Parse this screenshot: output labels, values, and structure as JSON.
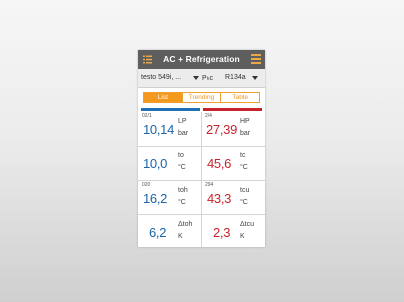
{
  "header": {
    "title": "AC + Refrigeration",
    "menu_icon": "list-icon",
    "hamburger_icon": "hamburger-icon"
  },
  "selectors": {
    "device": "testo 549i, ...",
    "param": "Pₕc",
    "refrigerant": "R134a"
  },
  "tabs": [
    {
      "label": "List"
    },
    {
      "label": "Trending"
    },
    {
      "label": "Table"
    }
  ],
  "colors": {
    "low": "#1a63a8",
    "high": "#c8232c",
    "accent": "#f39a1e",
    "header": "#5e5e5e"
  },
  "cells": [
    {
      "code": "02/1",
      "value": "10,14",
      "label1": "LP",
      "label2": "bar",
      "color": "blue"
    },
    {
      "code": "2/4",
      "value": "27,39",
      "label1": "HP",
      "label2": "bar",
      "color": "red"
    },
    {
      "code": "",
      "value": "10,0",
      "label1": "to",
      "label2": "°C",
      "color": "blue"
    },
    {
      "code": "",
      "value": "45,6",
      "label1": "tc",
      "label2": "°C",
      "color": "red"
    },
    {
      "code": "020",
      "value": "16,2",
      "label1": "toh",
      "label2": "°C",
      "color": "blue"
    },
    {
      "code": "294",
      "value": "43,3",
      "label1": "tcu",
      "label2": "°C",
      "color": "red"
    },
    {
      "code": "",
      "value": "6,2",
      "label1": "Δtoh",
      "label2": "K",
      "color": "blue"
    },
    {
      "code": "",
      "value": "2,3",
      "label1": "Δtcu",
      "label2": "K",
      "color": "red"
    }
  ]
}
